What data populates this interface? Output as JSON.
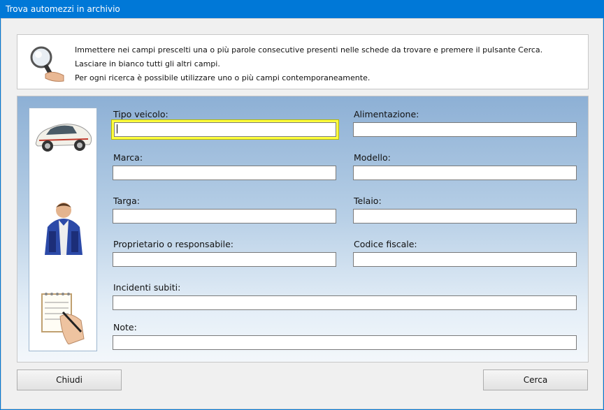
{
  "window": {
    "title": "Trova automezzi in archivio"
  },
  "info": {
    "line1": "Immettere nei campi prescelti una o più parole consecutive presenti nelle schede da trovare e premere il pulsante Cerca.",
    "line2": "Lasciare in bianco tutti gli altri campi.",
    "line3": "Per ogni ricerca è possibile utilizzare uno o più campi contemporaneamente."
  },
  "fields": {
    "tipo_veicolo": {
      "label": "Tipo veicolo:",
      "value": ""
    },
    "alimentazione": {
      "label": "Alimentazione:",
      "value": ""
    },
    "marca": {
      "label": "Marca:",
      "value": ""
    },
    "modello": {
      "label": "Modello:",
      "value": ""
    },
    "targa": {
      "label": "Targa:",
      "value": ""
    },
    "telaio": {
      "label": "Telaio:",
      "value": ""
    },
    "proprietario": {
      "label": "Proprietario o responsabile:",
      "value": ""
    },
    "codice_fiscale": {
      "label": "Codice fiscale:",
      "value": ""
    },
    "incidenti": {
      "label": "Incidenti subiti:",
      "value": ""
    },
    "note": {
      "label": "Note:",
      "value": ""
    }
  },
  "buttons": {
    "close": "Chiudi",
    "search": "Cerca"
  },
  "colors": {
    "titlebar": "#0078d7",
    "focus_border": "#ffff40"
  },
  "icons": [
    "magnifier-hand-icon",
    "car-icon",
    "mechanic-icon",
    "notepad-hand-icon"
  ]
}
